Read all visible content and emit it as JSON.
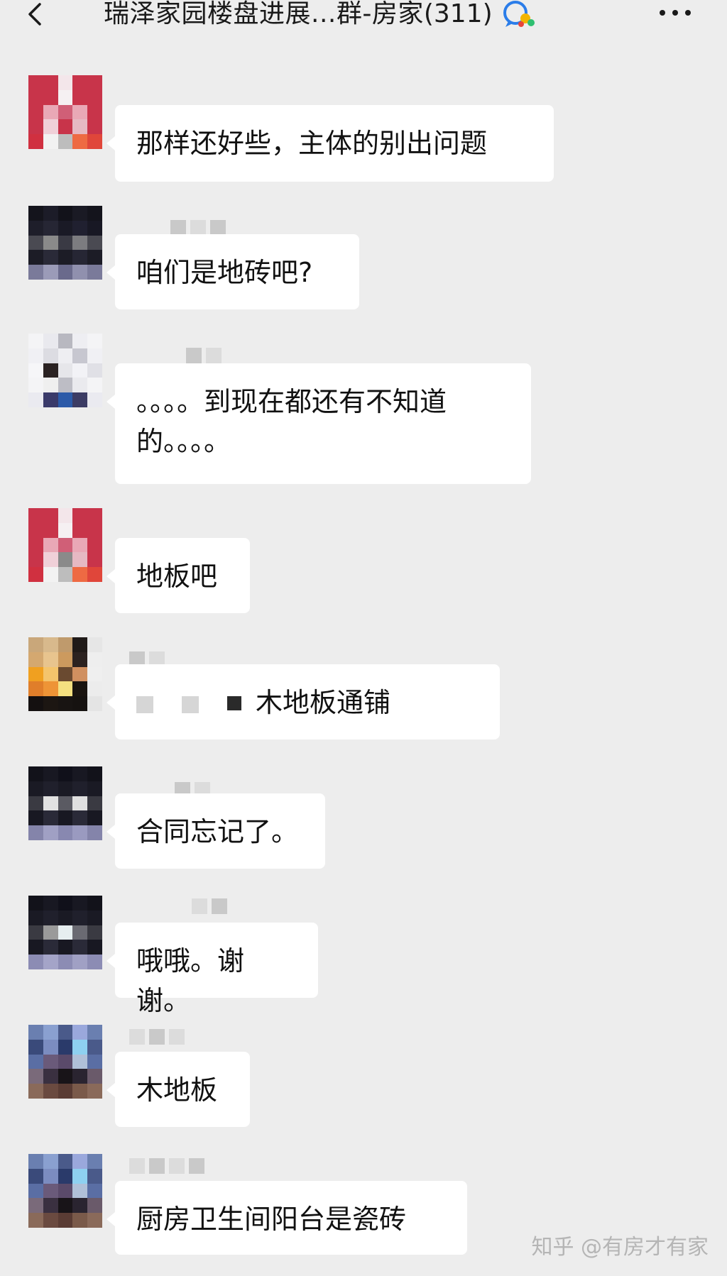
{
  "header": {
    "title": "瑞泽家园楼盘进展...群-房家",
    "member_count": "(311)",
    "back_icon": "chevron-left-icon",
    "more_icon": "more-horizontal-icon",
    "badge_icon": "chat-bubble-icon"
  },
  "messages": [
    {
      "text": "那样还好些，主体的别出问题"
    },
    {
      "text": "咱们是地砖吧?"
    },
    {
      "text": "。。。。到现在都还有不知道\n的。。。。"
    },
    {
      "text": "地板吧"
    },
    {
      "text": "木地板通铺"
    },
    {
      "text": "合同忘记了。"
    },
    {
      "text": "哦哦。谢谢。"
    },
    {
      "text": "木地板"
    },
    {
      "text": "厨房卫生间阳台是瓷砖"
    }
  ],
  "watermark": "知乎 @有房才有家",
  "colors": {
    "background": "#ededed",
    "bubble": "#ffffff",
    "text": "#111111"
  }
}
